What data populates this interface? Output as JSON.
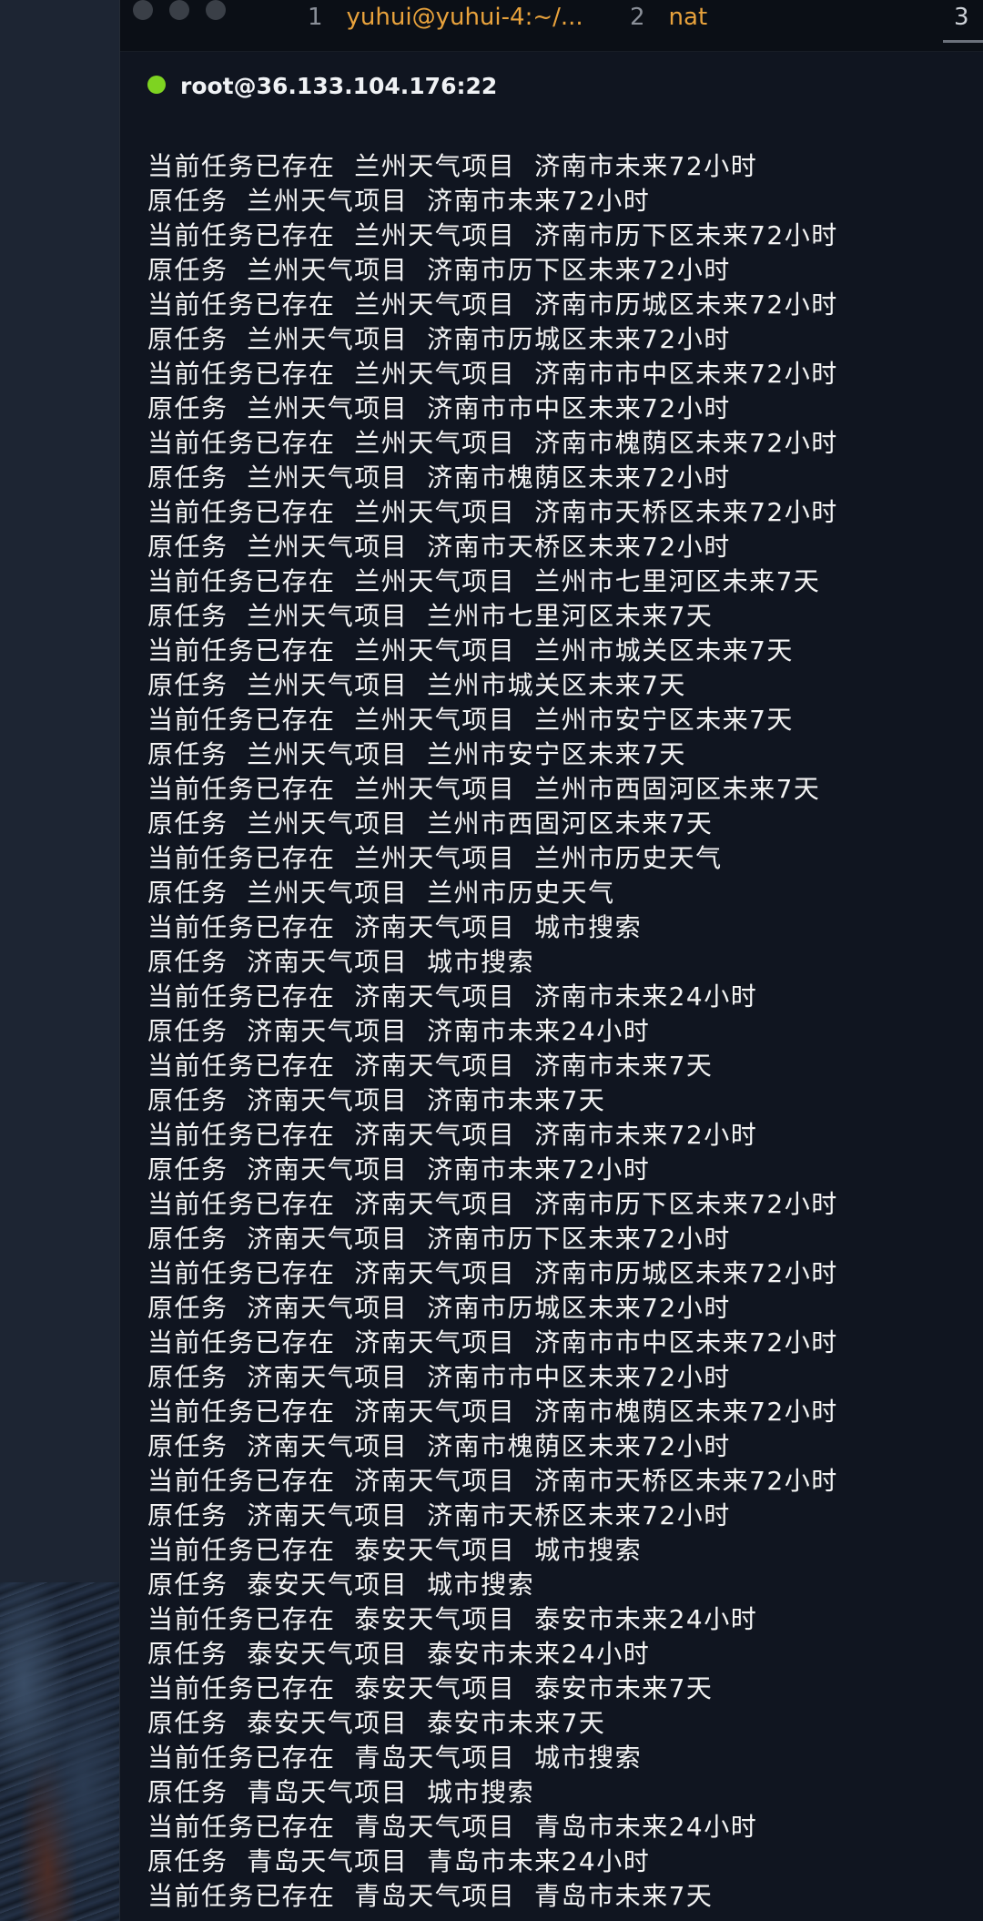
{
  "titlebar": {
    "tabs": [
      {
        "number": "1",
        "label": "yuhui@yuhui-4:~/..."
      },
      {
        "number": "2",
        "label": "nat"
      },
      {
        "number": "3",
        "label": ""
      }
    ]
  },
  "session": {
    "host": "root@36.133.104.176:22",
    "status_color": "#7ed321"
  },
  "terminal": {
    "lines": [
      "当前任务已存在  兰州天气项目  济南市未来72小时",
      "原任务  兰州天气项目  济南市未来72小时",
      "当前任务已存在  兰州天气项目  济南市历下区未来72小时",
      "原任务  兰州天气项目  济南市历下区未来72小时",
      "当前任务已存在  兰州天气项目  济南市历城区未来72小时",
      "原任务  兰州天气项目  济南市历城区未来72小时",
      "当前任务已存在  兰州天气项目  济南市市中区未来72小时",
      "原任务  兰州天气项目  济南市市中区未来72小时",
      "当前任务已存在  兰州天气项目  济南市槐荫区未来72小时",
      "原任务  兰州天气项目  济南市槐荫区未来72小时",
      "当前任务已存在  兰州天气项目  济南市天桥区未来72小时",
      "原任务  兰州天气项目  济南市天桥区未来72小时",
      "当前任务已存在  兰州天气项目  兰州市七里河区未来7天",
      "原任务  兰州天气项目  兰州市七里河区未来7天",
      "当前任务已存在  兰州天气项目  兰州市城关区未来7天",
      "原任务  兰州天气项目  兰州市城关区未来7天",
      "当前任务已存在  兰州天气项目  兰州市安宁区未来7天",
      "原任务  兰州天气项目  兰州市安宁区未来7天",
      "当前任务已存在  兰州天气项目  兰州市西固河区未来7天",
      "原任务  兰州天气项目  兰州市西固河区未来7天",
      "当前任务已存在  兰州天气项目  兰州市历史天气",
      "原任务  兰州天气项目  兰州市历史天气",
      "当前任务已存在  济南天气项目  城市搜索",
      "原任务  济南天气项目  城市搜索",
      "当前任务已存在  济南天气项目  济南市未来24小时",
      "原任务  济南天气项目  济南市未来24小时",
      "当前任务已存在  济南天气项目  济南市未来7天",
      "原任务  济南天气项目  济南市未来7天",
      "当前任务已存在  济南天气项目  济南市未来72小时",
      "原任务  济南天气项目  济南市未来72小时",
      "当前任务已存在  济南天气项目  济南市历下区未来72小时",
      "原任务  济南天气项目  济南市历下区未来72小时",
      "当前任务已存在  济南天气项目  济南市历城区未来72小时",
      "原任务  济南天气项目  济南市历城区未来72小时",
      "当前任务已存在  济南天气项目  济南市市中区未来72小时",
      "原任务  济南天气项目  济南市市中区未来72小时",
      "当前任务已存在  济南天气项目  济南市槐荫区未来72小时",
      "原任务  济南天气项目  济南市槐荫区未来72小时",
      "当前任务已存在  济南天气项目  济南市天桥区未来72小时",
      "原任务  济南天气项目  济南市天桥区未来72小时",
      "当前任务已存在  泰安天气项目  城市搜索",
      "原任务  泰安天气项目  城市搜索",
      "当前任务已存在  泰安天气项目  泰安市未来24小时",
      "原任务  泰安天气项目  泰安市未来24小时",
      "当前任务已存在  泰安天气项目  泰安市未来7天",
      "原任务  泰安天气项目  泰安市未来7天",
      "当前任务已存在  青岛天气项目  城市搜索",
      "原任务  青岛天气项目  城市搜索",
      "当前任务已存在  青岛天气项目  青岛市未来24小时",
      "原任务  青岛天气项目  青岛市未来24小时",
      "当前任务已存在  青岛天气项目  青岛市未来7天"
    ]
  }
}
